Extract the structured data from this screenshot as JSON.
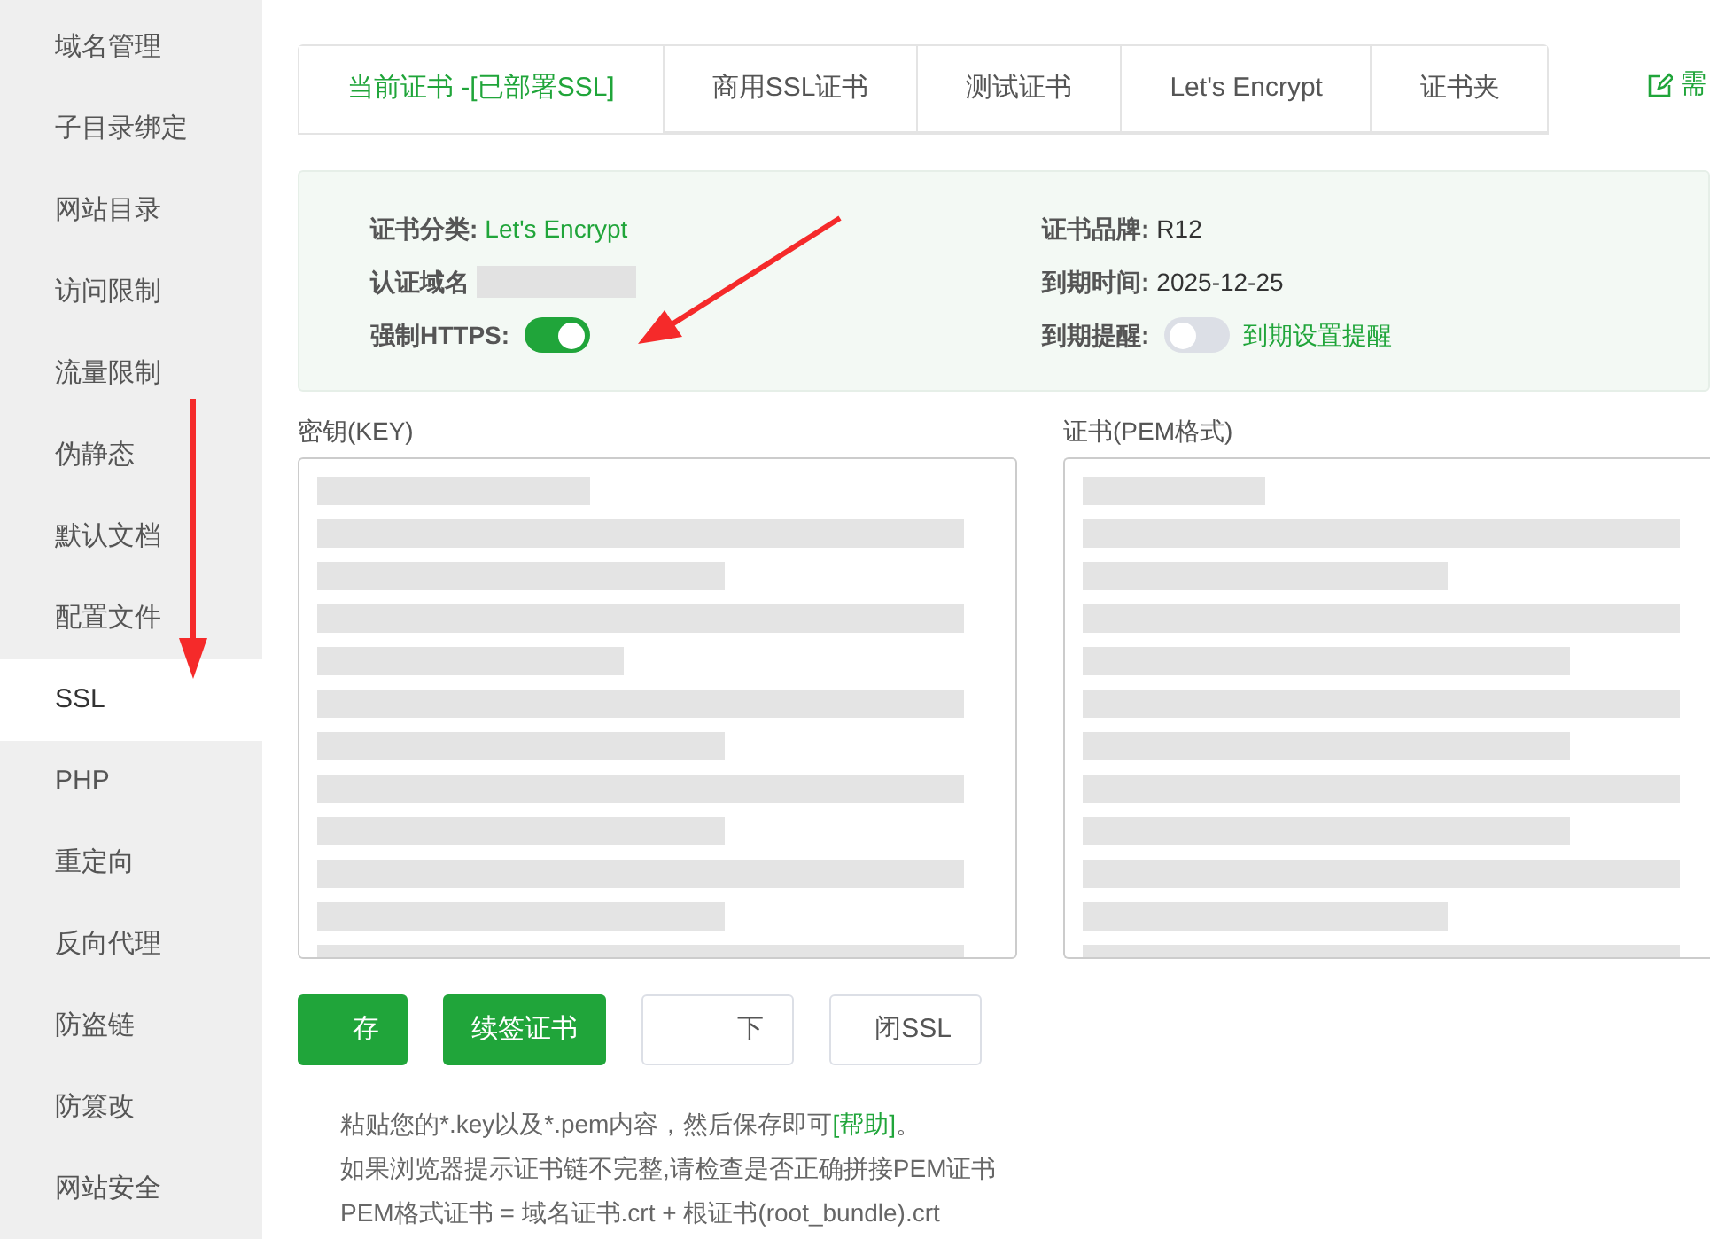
{
  "sidebar": {
    "items": [
      {
        "label": "域名管理",
        "selected": false
      },
      {
        "label": "子目录绑定",
        "selected": false
      },
      {
        "label": "网站目录",
        "selected": false
      },
      {
        "label": "访问限制",
        "selected": false
      },
      {
        "label": "流量限制",
        "selected": false
      },
      {
        "label": "伪静态",
        "selected": false
      },
      {
        "label": "默认文档",
        "selected": false
      },
      {
        "label": "配置文件",
        "selected": false
      },
      {
        "label": "SSL",
        "selected": true
      },
      {
        "label": "PHP",
        "selected": false
      },
      {
        "label": "重定向",
        "selected": false
      },
      {
        "label": "反向代理",
        "selected": false
      },
      {
        "label": "防盗链",
        "selected": false
      },
      {
        "label": "防篡改",
        "selected": false
      },
      {
        "label": "网站安全",
        "selected": false
      }
    ]
  },
  "tabs": [
    {
      "label": "当前证书 -[已部署SSL]",
      "selected": true
    },
    {
      "label": "商用SSL证书",
      "selected": false
    },
    {
      "label": "测试证书",
      "selected": false
    },
    {
      "label": "Let's Encrypt",
      "selected": false
    },
    {
      "label": "证书夹",
      "selected": false
    }
  ],
  "top_right_link": "需",
  "info": {
    "left": [
      {
        "kind": "text",
        "label": "证书分类:",
        "value": "Let's Encrypt",
        "green": true
      },
      {
        "kind": "redacted",
        "label": "认证域名"
      },
      {
        "kind": "switch",
        "label": "强制HTTPS:",
        "on": true
      }
    ],
    "right": [
      {
        "kind": "text",
        "label": "证书品牌:",
        "value": "R12",
        "green": false
      },
      {
        "kind": "text",
        "label": "到期时间:",
        "value": "2025-12-25",
        "green": false
      },
      {
        "kind": "switch",
        "label": "到期提醒:",
        "on": false,
        "link": "到期设置提醒"
      }
    ]
  },
  "key_label": "密钥(KEY)",
  "cert_label": "证书(PEM格式)",
  "buttons": [
    {
      "label": "存",
      "primary": true
    },
    {
      "label": "续签证书",
      "primary": true
    },
    {
      "label": "下",
      "primary": false
    },
    {
      "label": "闭SSL",
      "primary": false
    }
  ],
  "notes": [
    {
      "text": "粘贴您的*.key以及*.pem内容，然后保存即可",
      "link": "[帮助]",
      "after": "。"
    },
    {
      "text": "如果浏览器提示证书链不完整,请检查是否正确拼接PEM证书"
    },
    {
      "text": "PEM格式证书 = 域名证书.crt + 根证书(root_bundle).crt"
    }
  ]
}
